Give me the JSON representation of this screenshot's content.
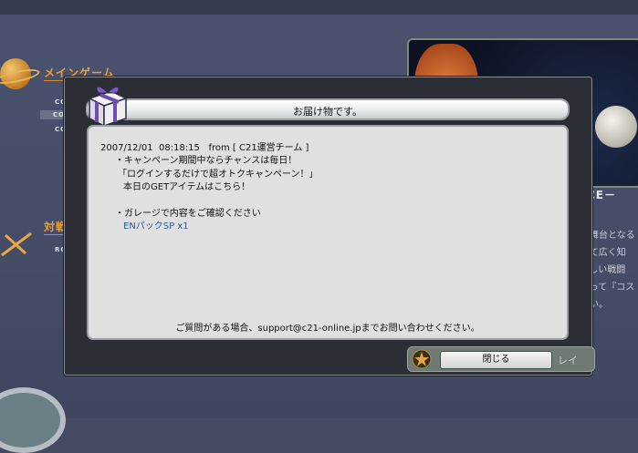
{
  "background": {
    "sections": {
      "main_game": {
        "title": "メインゲーム",
        "items": [
          "COSMOS",
          "COSMOS",
          "COSMOS"
        ]
      },
      "versus": {
        "title": "対戦（P",
        "items": [
          "ROBO"
        ]
      }
    },
    "banner_caption": "SANCE－",
    "story_lines": [
      "主要な舞台となる",
      "域として広く知",
      "ず、激しい戦闘",
      "員となって『コス",
      "ください。"
    ]
  },
  "dialog": {
    "title": "お届け物です。",
    "header_line": "2007/12/01  08:18:15   from [ C21運営チーム ]",
    "lines": [
      "・キャンペーン期間中ならチャンスは毎日！",
      "「ログインするだけで超オトクキャンペーン！」",
      "本日のGETアイテムはこちら！",
      "・ガレージで内容をご確認ください"
    ],
    "item": "ENパックSP x1",
    "footer": "ご質問がある場合、support@c21-online.jpまでお問い合わせください。",
    "close_label": "閉じる",
    "ghost_label": "レイ"
  }
}
